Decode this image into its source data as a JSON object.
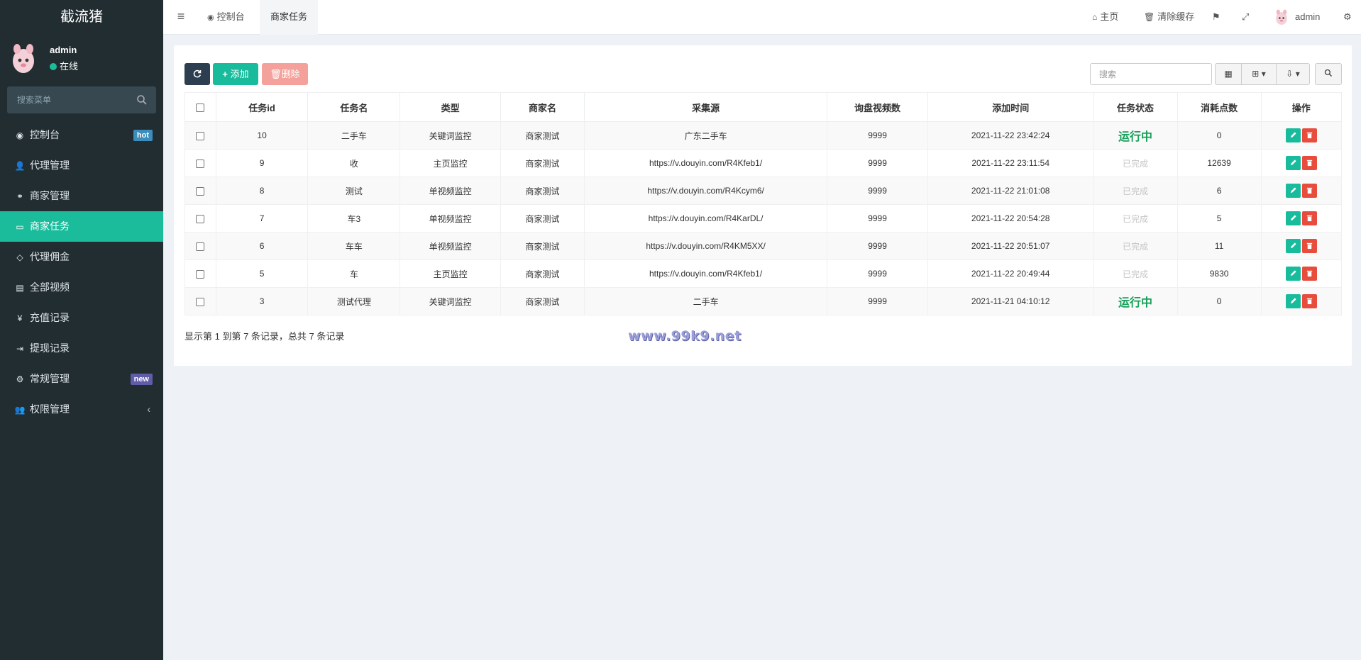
{
  "app": {
    "title": "截流猪"
  },
  "user": {
    "name": "admin",
    "status": "在线"
  },
  "sidebar": {
    "search_placeholder": "搜索菜单",
    "items": [
      {
        "label": "控制台",
        "badge": "hot"
      },
      {
        "label": "代理管理"
      },
      {
        "label": "商家管理"
      },
      {
        "label": "商家任务"
      },
      {
        "label": "代理佣金"
      },
      {
        "label": "全部视频"
      },
      {
        "label": "充值记录"
      },
      {
        "label": "提现记录"
      },
      {
        "label": "常规管理",
        "badge": "new"
      },
      {
        "label": "权限管理"
      }
    ]
  },
  "header": {
    "tabs": [
      {
        "label": "控制台"
      },
      {
        "label": "商家任务"
      }
    ],
    "home": "主页",
    "clear_cache": "清除缓存",
    "user": "admin"
  },
  "toolbar": {
    "add_label": "添加",
    "delete_label": "删除",
    "search_placeholder": "搜索"
  },
  "table": {
    "columns": [
      "任务id",
      "任务名",
      "类型",
      "商家名",
      "采集源",
      "询盘视频数",
      "添加时间",
      "任务状态",
      "消耗点数",
      "操作"
    ],
    "rows": [
      {
        "id": "10",
        "name": "二手车",
        "type": "关键词监控",
        "merchant": "商家测试",
        "source": "广东二手车",
        "count": "9999",
        "time": "2021-11-22 23:42:24",
        "status": "运行中",
        "points": "0"
      },
      {
        "id": "9",
        "name": "收",
        "type": "主页监控",
        "merchant": "商家测试",
        "source": "https://v.douyin.com/R4Kfeb1/",
        "count": "9999",
        "time": "2021-11-22 23:11:54",
        "status": "已完成",
        "points": "12639"
      },
      {
        "id": "8",
        "name": "测试",
        "type": "单视频监控",
        "merchant": "商家测试",
        "source": "https://v.douyin.com/R4Kcym6/",
        "count": "9999",
        "time": "2021-11-22 21:01:08",
        "status": "已完成",
        "points": "6"
      },
      {
        "id": "7",
        "name": "车3",
        "type": "单视频监控",
        "merchant": "商家测试",
        "source": "https://v.douyin.com/R4KarDL/",
        "count": "9999",
        "time": "2021-11-22 20:54:28",
        "status": "已完成",
        "points": "5"
      },
      {
        "id": "6",
        "name": "车车",
        "type": "单视频监控",
        "merchant": "商家测试",
        "source": "https://v.douyin.com/R4KM5XX/",
        "count": "9999",
        "time": "2021-11-22 20:51:07",
        "status": "已完成",
        "points": "11"
      },
      {
        "id": "5",
        "name": "车",
        "type": "主页监控",
        "merchant": "商家测试",
        "source": "https://v.douyin.com/R4Kfeb1/",
        "count": "9999",
        "time": "2021-11-22 20:49:44",
        "status": "已完成",
        "points": "9830"
      },
      {
        "id": "3",
        "name": "测试代理",
        "type": "关键词监控",
        "merchant": "商家测试",
        "source": "二手车",
        "count": "9999",
        "time": "2021-11-21 04:10:12",
        "status": "运行中",
        "points": "0"
      }
    ]
  },
  "pagination": {
    "info": "显示第 1 到第 7 条记录，总共 7 条记录"
  },
  "watermark": "www.99k9.net",
  "colors": {
    "sidebar": "#222d32",
    "accent": "#1abc9c",
    "danger": "#e74c3c",
    "dark": "#2c3e50",
    "running": "#18a05a"
  }
}
